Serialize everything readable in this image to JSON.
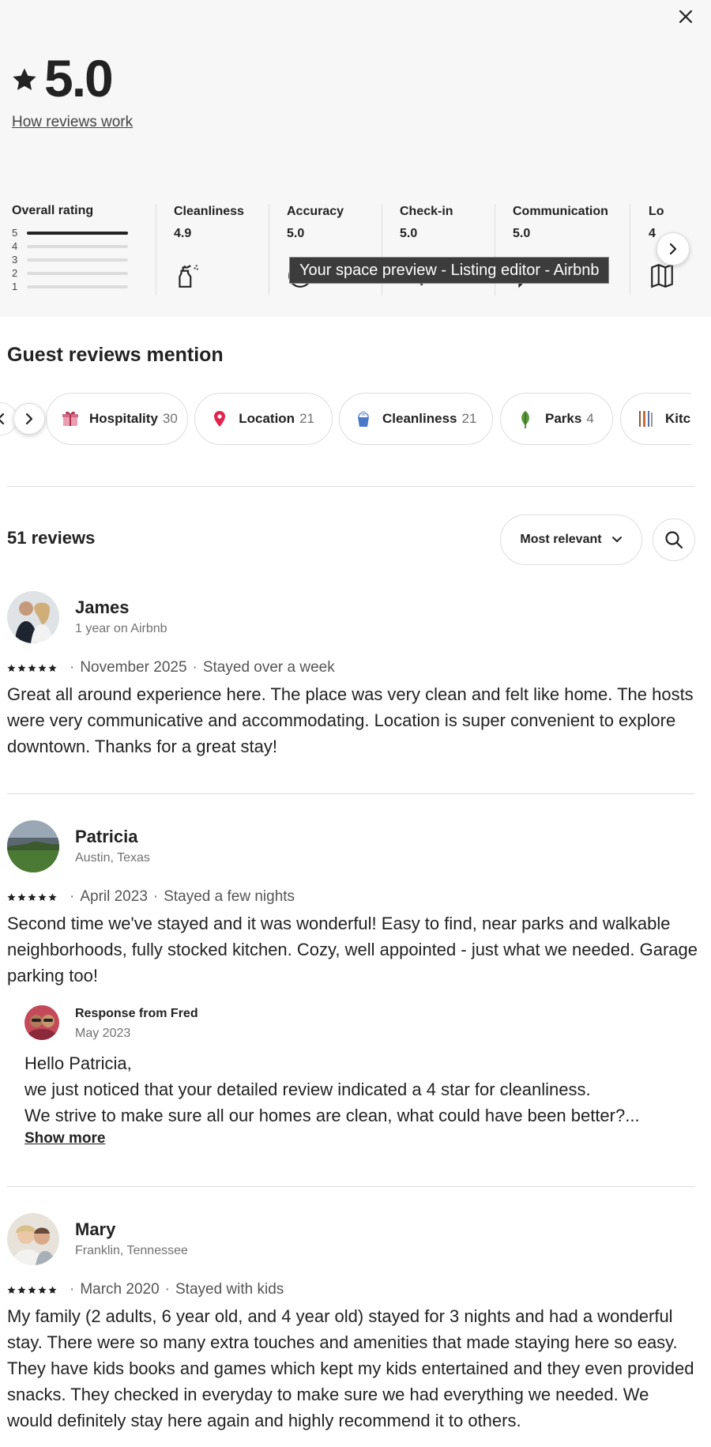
{
  "summary": {
    "rating": "5.0",
    "how_link": "How reviews work"
  },
  "categories": {
    "overall": {
      "label": "Overall rating",
      "rows": [
        {
          "n": "5",
          "fraction": 1.0
        },
        {
          "n": "4",
          "fraction": 0.0
        },
        {
          "n": "3",
          "fraction": 0.0
        },
        {
          "n": "2",
          "fraction": 0.0
        },
        {
          "n": "1",
          "fraction": 0.0
        }
      ]
    },
    "items": [
      {
        "label": "Cleanliness",
        "value": "4.9",
        "icon": "spray-bottle-icon"
      },
      {
        "label": "Accuracy",
        "value": "5.0",
        "icon": "check-circle-icon"
      },
      {
        "label": "Check-in",
        "value": "5.0",
        "icon": "key-icon"
      },
      {
        "label": "Communication",
        "value": "5.0",
        "icon": "message-bubble-icon"
      },
      {
        "label": "Lo",
        "value": "4",
        "icon": "map-icon"
      }
    ]
  },
  "tooltip": "Your space preview - Listing editor - Airbnb",
  "mentions": {
    "title": "Guest reviews mention",
    "chips": [
      {
        "label": "Hospitality",
        "count": "30",
        "icon": "gift-icon"
      },
      {
        "label": "Location",
        "count": "21",
        "icon": "map-pin-icon"
      },
      {
        "label": "Cleanliness",
        "count": "21",
        "icon": "cleaning-bucket-icon"
      },
      {
        "label": "Parks",
        "count": "4",
        "icon": "leaf-icon"
      },
      {
        "label": "Kitc",
        "count": "",
        "icon": "utensils-icon"
      }
    ]
  },
  "reviews_header": {
    "count": "51 reviews",
    "sort_label": "Most relevant"
  },
  "reviews": [
    {
      "name": "James",
      "sub": "1 year on Airbnb",
      "date": "November 2025",
      "stay": "Stayed over a week",
      "stars": 5,
      "text": "Great all around experience here. The place was very clean and felt like home. The hosts were very communicative and accommodating. Location is super convenient to explore downtown. Thanks for a great stay!"
    },
    {
      "name": "Patricia",
      "sub": "Austin, Texas",
      "date": "April 2023",
      "stay": "Stayed a few nights",
      "stars": 5,
      "text": "Second time we've stayed and it was wonderful! Easy to find, near parks and walkable neighborhoods, fully stocked kitchen. Cozy, well appointed - just what we needed. Garage parking too!",
      "response": {
        "from": "Response from Fred",
        "date": "May 2023",
        "line1": "Hello Patricia,",
        "line2": "we just noticed that your detailed review indicated a 4 star for cleanliness.",
        "line3": "We strive to make sure all our homes are clean, what could have been better?...",
        "show_more": "Show more"
      }
    },
    {
      "name": "Mary",
      "sub": "Franklin, Tennessee",
      "date": "March 2020",
      "stay": "Stayed with kids",
      "stars": 5,
      "text": "My family (2 adults, 6 year old, and 4 year old) stayed for 3 nights and had a wonderful stay. There were so many extra touches and amenities that made staying here so easy. They have kids books and games which kept my kids entertained and they even provided snacks. They checked in everyday to make sure we had everything we needed. We would definitely stay here again and highly recommend it to others."
    }
  ],
  "dot_separator": "·"
}
